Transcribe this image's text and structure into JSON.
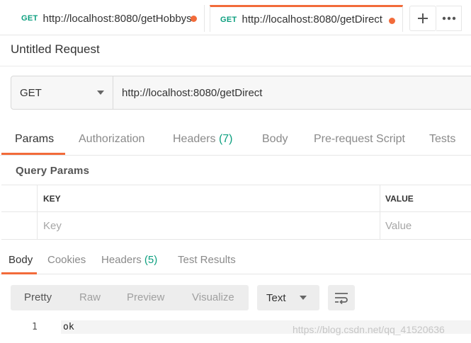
{
  "tabs": [
    {
      "method": "GET",
      "url": "http://localhost:8080/getHobbys"
    },
    {
      "method": "GET",
      "url": "http://localhost:8080/getDirect"
    }
  ],
  "tab_actions": {
    "add_icon": "plus-icon",
    "more_icon": "more-horizontal-icon"
  },
  "request": {
    "title": "Untitled Request",
    "method": "GET",
    "url": "http://localhost:8080/getDirect"
  },
  "request_tabs": [
    {
      "label": "Params"
    },
    {
      "label": "Authorization"
    },
    {
      "label": "Headers",
      "count": "(7)"
    },
    {
      "label": "Body"
    },
    {
      "label": "Pre-request Script"
    },
    {
      "label": "Tests"
    }
  ],
  "query_params": {
    "title": "Query Params",
    "headers": {
      "key": "KEY",
      "value": "VALUE"
    },
    "placeholders": {
      "key": "Key",
      "value": "Value"
    }
  },
  "response_tabs": [
    {
      "label": "Body"
    },
    {
      "label": "Cookies"
    },
    {
      "label": "Headers",
      "count": "(5)"
    },
    {
      "label": "Test Results"
    }
  ],
  "response_view": {
    "modes": [
      "Pretty",
      "Raw",
      "Preview",
      "Visualize"
    ],
    "active_mode": "Pretty",
    "format": "Text",
    "wrap_icon": "wrap-lines-icon"
  },
  "response_body": {
    "line_number": "1",
    "text": "ok"
  },
  "watermark": "https://blog.csdn.net/qq_41520636",
  "colors": {
    "accent": "#f26b3a",
    "method_green": "#0c9f7f"
  }
}
